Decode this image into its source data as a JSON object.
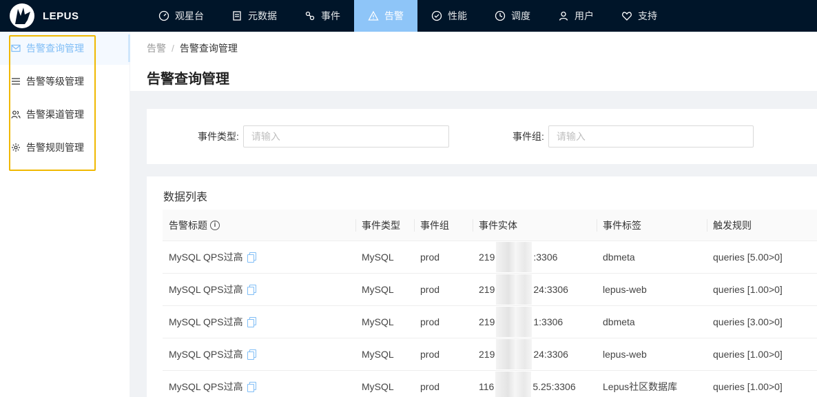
{
  "app": {
    "brand": "LEPUS"
  },
  "nav": [
    {
      "label": "观星台",
      "icon": "dashboard-icon",
      "active": false
    },
    {
      "label": "元数据",
      "icon": "database-icon",
      "active": false
    },
    {
      "label": "事件",
      "icon": "event-icon",
      "active": false
    },
    {
      "label": "告警",
      "icon": "warning-icon",
      "active": true
    },
    {
      "label": "性能",
      "icon": "performance-icon",
      "active": false
    },
    {
      "label": "调度",
      "icon": "schedule-icon",
      "active": false
    },
    {
      "label": "用户",
      "icon": "user-icon",
      "active": false
    },
    {
      "label": "支持",
      "icon": "heart-icon",
      "active": false
    }
  ],
  "sidebar": {
    "items": [
      {
        "label": "告警查询管理",
        "icon": "mail-icon",
        "active": true
      },
      {
        "label": "告警等级管理",
        "icon": "list-icon",
        "active": false
      },
      {
        "label": "告警渠道管理",
        "icon": "users-icon",
        "active": false
      },
      {
        "label": "告警规则管理",
        "icon": "gear-icon",
        "active": false
      }
    ]
  },
  "breadcrumb": {
    "parent": "告警",
    "sep": "/",
    "current": "告警查询管理"
  },
  "page": {
    "title": "告警查询管理"
  },
  "filters": {
    "event_type": {
      "label": "事件类型:",
      "placeholder": "请输入"
    },
    "event_group": {
      "label": "事件组:",
      "placeholder": "请输入"
    }
  },
  "list": {
    "title": "数据列表",
    "columns": [
      "告警标题",
      "事件类型",
      "事件组",
      "事件实体",
      "事件标签",
      "触发规则"
    ],
    "rows": [
      {
        "title": "MySQL QPS过高",
        "type": "MySQL",
        "group": "prod",
        "entity_pre": "219",
        "entity_post": ":3306",
        "tag": "dbmeta",
        "rule": "queries [5.00>0]"
      },
      {
        "title": "MySQL QPS过高",
        "type": "MySQL",
        "group": "prod",
        "entity_pre": "219",
        "entity_post": "24:3306",
        "tag": "lepus-web",
        "rule": "queries [1.00>0]"
      },
      {
        "title": "MySQL QPS过高",
        "type": "MySQL",
        "group": "prod",
        "entity_pre": "219",
        "entity_post": "1:3306",
        "tag": "dbmeta",
        "rule": "queries [3.00>0]"
      },
      {
        "title": "MySQL QPS过高",
        "type": "MySQL",
        "group": "prod",
        "entity_pre": "219",
        "entity_post": "24:3306",
        "tag": "lepus-web",
        "rule": "queries [1.00>0]"
      },
      {
        "title": "MySQL QPS过高",
        "type": "MySQL",
        "group": "prod",
        "entity_pre": "116",
        "entity_post": "5.25:3306",
        "tag": "Lepus社区数据库",
        "rule": "queries [1.00>0]"
      }
    ]
  },
  "colors": {
    "nav_bg": "#001529",
    "active_blue": "#8ec5f8",
    "highlight_box": "#f0b800"
  }
}
